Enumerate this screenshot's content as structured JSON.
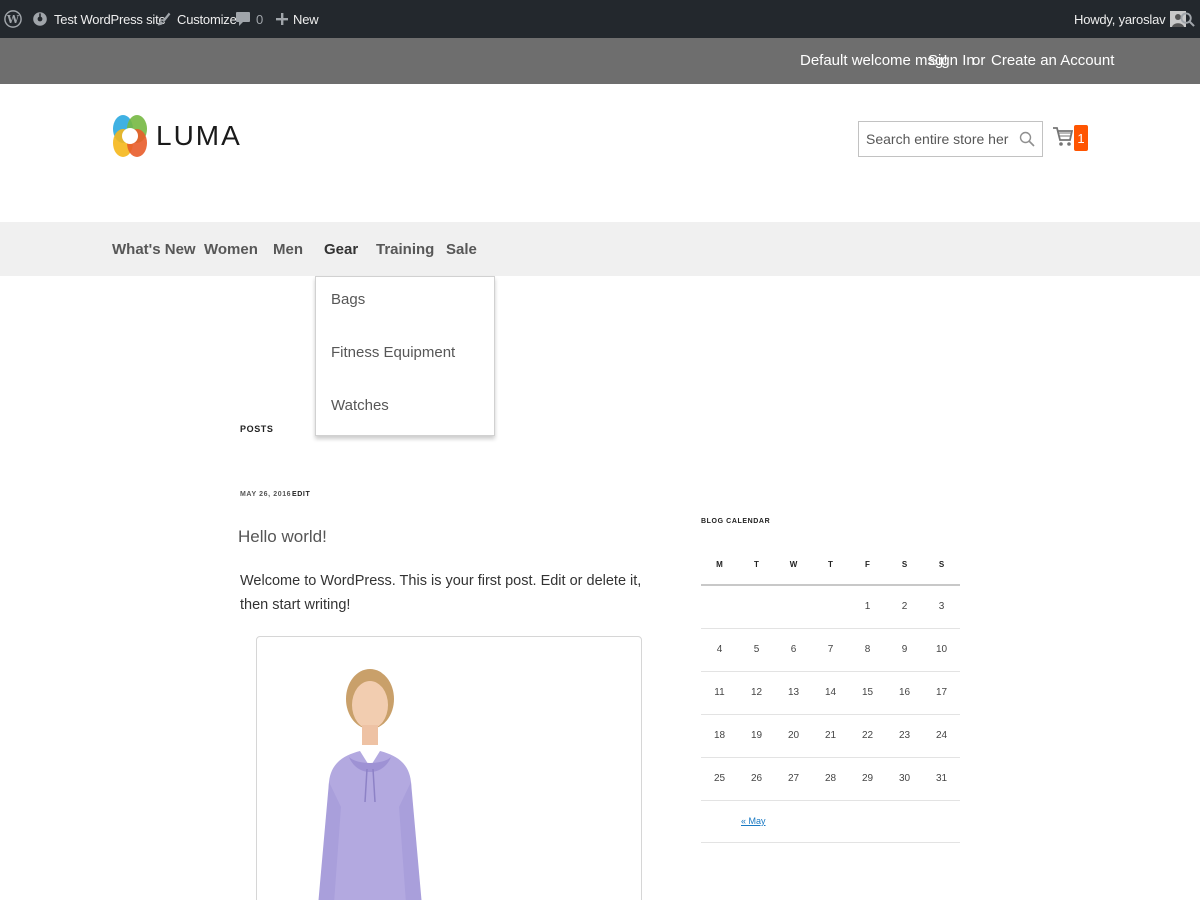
{
  "admin_bar": {
    "site_name": "Test WordPress site",
    "customize": "Customize",
    "comments_count": "0",
    "new": "New",
    "howdy": "Howdy, yaroslav"
  },
  "panel": {
    "welcome": "Default welcome msg!",
    "sign_in": "Sign In",
    "or": "or",
    "create_account": "Create an Account"
  },
  "header": {
    "logo_text": "LUMA",
    "search_placeholder": "Search entire store here...",
    "cart_count": "1"
  },
  "nav": {
    "items": [
      "What's New",
      "Women",
      "Men",
      "Gear",
      "Training",
      "Sale"
    ],
    "active": "Gear"
  },
  "dropdown": {
    "items": [
      "Bags",
      "Fitness Equipment",
      "Watches"
    ]
  },
  "content": {
    "posts_heading": "POSTS",
    "post_date": "MAY 26, 2016",
    "edit": "EDIT",
    "post_title": "Hello world!",
    "post_body": "Welcome to WordPress. This is your first post. Edit or delete it, then start writing!"
  },
  "calendar": {
    "heading": "BLOG CALENDAR",
    "days": [
      "M",
      "T",
      "W",
      "T",
      "F",
      "S",
      "S"
    ],
    "weeks": [
      [
        "",
        "",
        "",
        "",
        "1",
        "2",
        "3"
      ],
      [
        "4",
        "5",
        "6",
        "7",
        "8",
        "9",
        "10"
      ],
      [
        "11",
        "12",
        "13",
        "14",
        "15",
        "16",
        "17"
      ],
      [
        "18",
        "19",
        "20",
        "21",
        "22",
        "23",
        "24"
      ],
      [
        "25",
        "26",
        "27",
        "28",
        "29",
        "30",
        "31"
      ]
    ],
    "prev_link": "« May"
  },
  "colors": {
    "admin_bar_bg": "#23282d",
    "panel_bg": "#6e6e6e",
    "nav_bg": "#f0f0f0",
    "cart_badge": "#ff5501",
    "link": "#1979c3"
  },
  "icons": [
    "wordpress-logo-icon",
    "dashboard-icon",
    "customize-brush-icon",
    "comment-icon",
    "plus-icon",
    "avatar",
    "search-icon",
    "cart-icon"
  ]
}
